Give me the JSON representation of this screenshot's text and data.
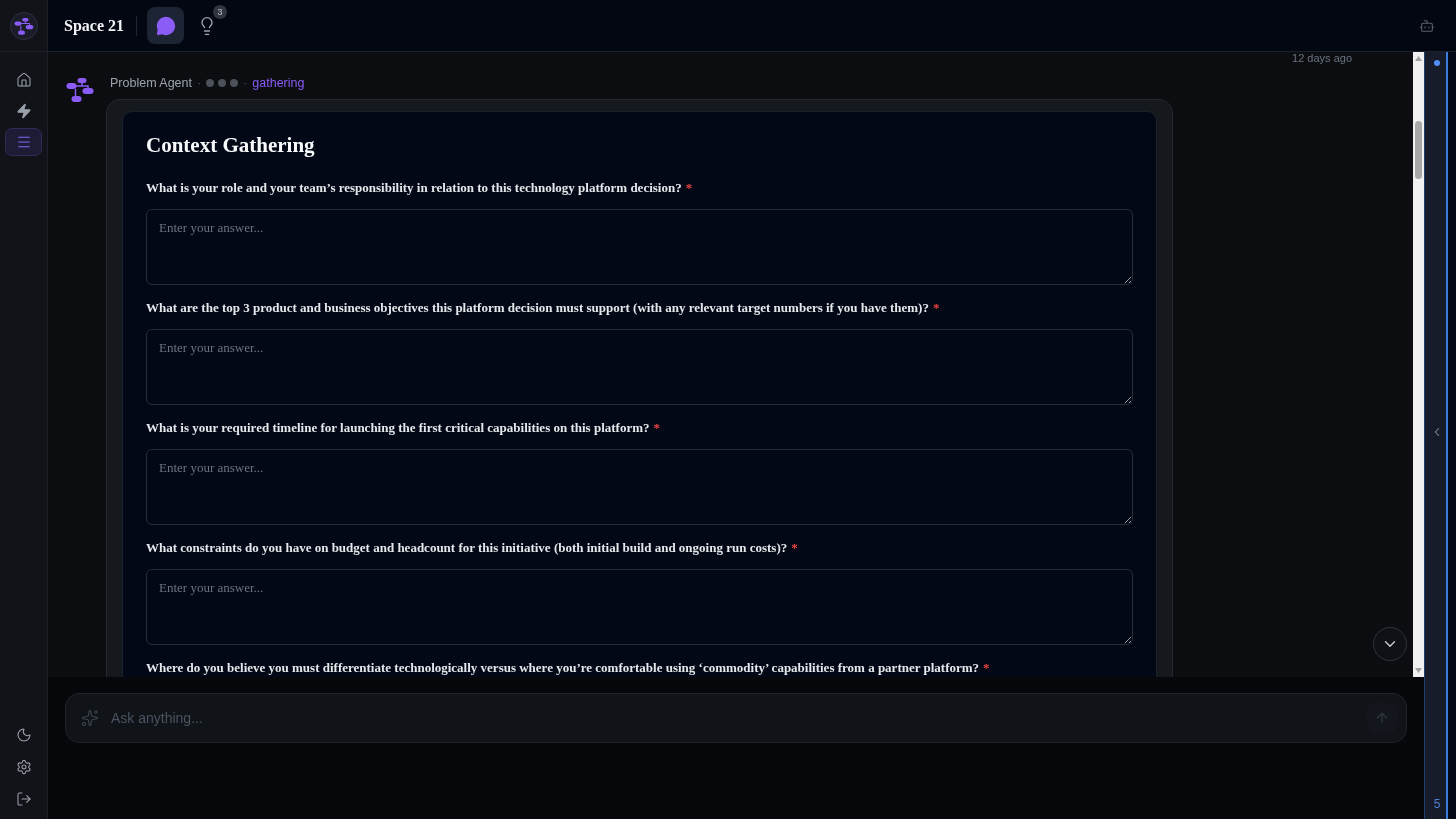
{
  "sidebar": {
    "nav": [
      {
        "kind": "home",
        "selected": false
      },
      {
        "kind": "actions",
        "selected": false
      },
      {
        "kind": "list",
        "selected": true
      }
    ]
  },
  "topbar": {
    "title": "Space 21",
    "tabs": [
      {
        "kind": "chat",
        "selected": true
      },
      {
        "kind": "ideas",
        "selected": false,
        "badge": "3"
      }
    ]
  },
  "chat": {
    "timestamp": "12 days ago",
    "message": {
      "header": [
        {
          "kind": "name",
          "text": "Problem Agent"
        },
        {
          "kind": "separator",
          "text": "·"
        },
        {
          "kind": "typing"
        },
        {
          "kind": "separator",
          "text": "·"
        },
        {
          "kind": "status",
          "text": "gathering"
        }
      ],
      "form": {
        "title": "Context Gathering",
        "questions": [
          {
            "label": "What is your role and your team’s responsibility in relation to this technology platform decision?",
            "required_mark": "*",
            "placeholder": "Enter your answer..."
          },
          {
            "label": "What are the top 3 product and business objectives this platform decision must support (with any relevant target numbers if you have them)?",
            "required_mark": "*",
            "placeholder": "Enter your answer..."
          },
          {
            "label": "What is your required timeline for launching the first critical capabilities on this platform?",
            "required_mark": "*",
            "placeholder": "Enter your answer..."
          },
          {
            "label": "What constraints do you have on budget and headcount for this initiative (both initial build and ongoing run costs)?",
            "required_mark": "*",
            "placeholder": "Enter your answer..."
          },
          {
            "label": "Where do you believe you must differentiate technologically versus where you’re comfortable using ‘commodity’ capabilities from a partner platform?",
            "required_mark": "*"
          }
        ]
      }
    }
  },
  "composer": {
    "placeholder": "Ask anything..."
  },
  "right_panel": {
    "count": "5"
  }
}
